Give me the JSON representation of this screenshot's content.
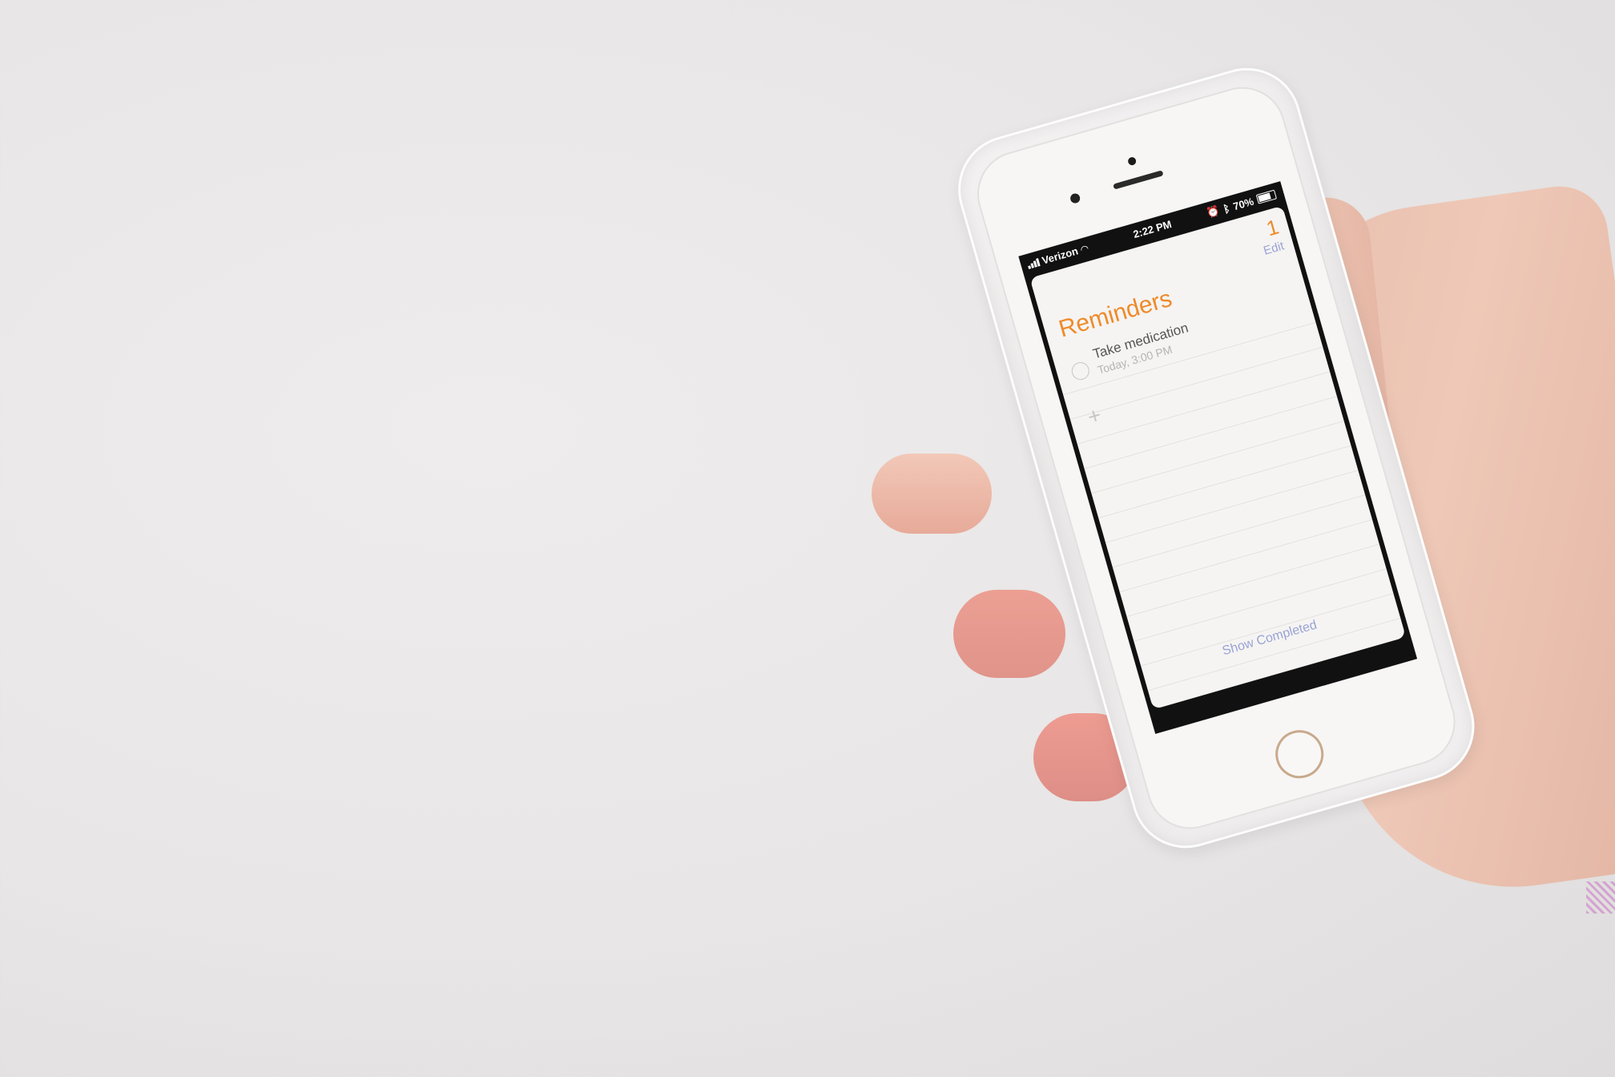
{
  "status_bar": {
    "carrier": "Verizon",
    "time": "2:22 PM",
    "battery": "70%"
  },
  "reminders": {
    "count": "1",
    "edit_label": "Edit",
    "title": "Reminders",
    "items": [
      {
        "title": "Take medication",
        "subtitle": "Today, 3:00 PM"
      }
    ],
    "show_completed_label": "Show Completed"
  },
  "colors": {
    "accent_orange": "#ef8a2a",
    "link_blue": "#9aa3d6"
  }
}
